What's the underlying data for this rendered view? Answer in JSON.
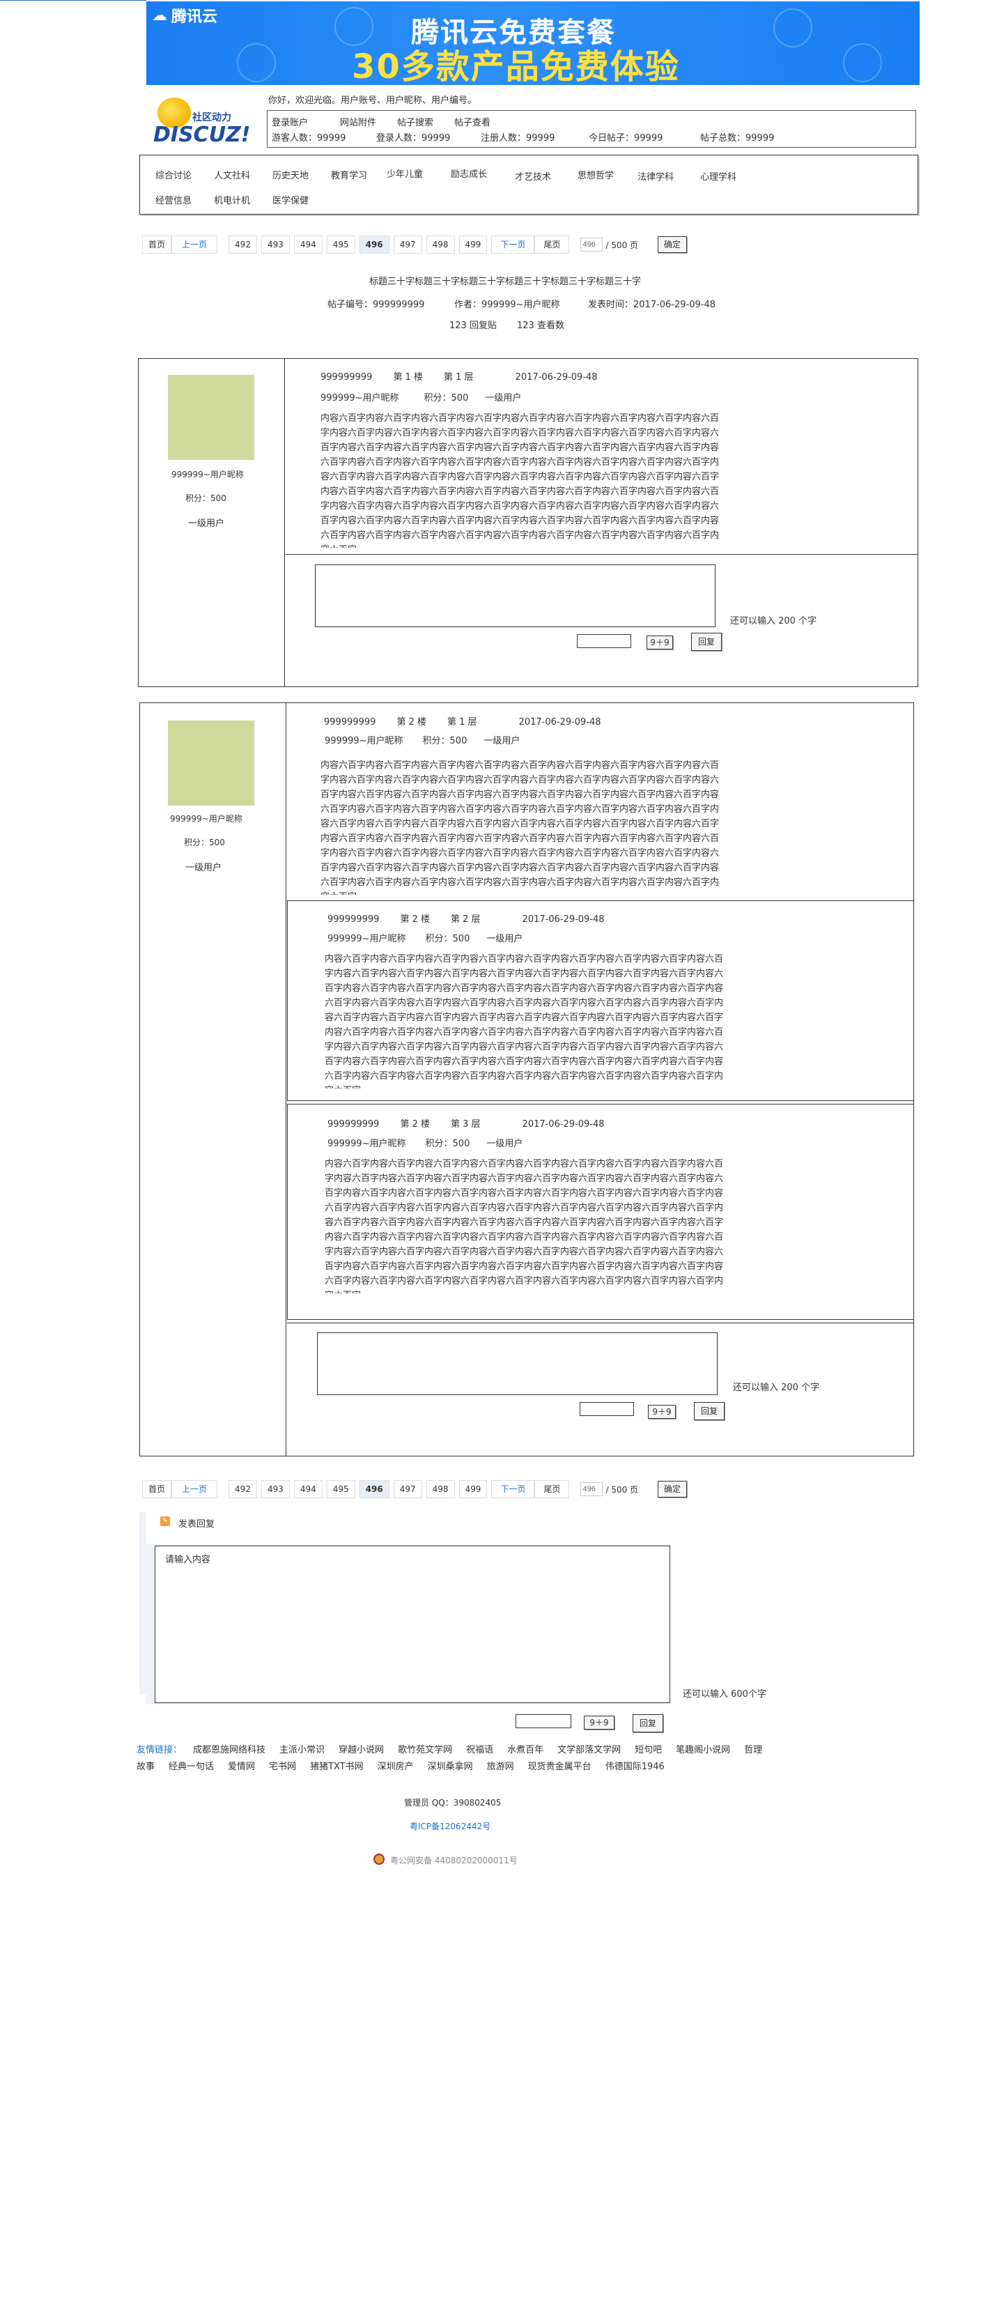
{
  "banner": {
    "brand": "腾讯云",
    "title_line1": "腾讯云免费套餐",
    "title_line2": "30多款产品免费体验"
  },
  "logo": {
    "text_top": "社区动力",
    "text_main": "DISCUZ!"
  },
  "greeting": "你好，欢迎光临。用户账号、用户昵称、用户编号。",
  "stats": {
    "row1": [
      "登录账户",
      "网站附件",
      "帖子搜索",
      "帖子查看"
    ],
    "row2": [
      "游客人数：99999",
      "登录人数：99999",
      "注册人数：99999",
      "今日帖子：99999",
      "帖子总数：99999"
    ]
  },
  "nav": {
    "row1": [
      "综合讨论",
      "人文社科",
      "历史天地",
      "教育学习",
      "少年儿童",
      "励志成长",
      "才艺技术",
      "思想哲学",
      "法律学科",
      "心理学科"
    ],
    "row2": [
      "经营信息",
      "机电计机",
      "医学保健"
    ]
  },
  "pager": {
    "first": "首页",
    "prev": "上一页",
    "pages": [
      "492",
      "493",
      "494",
      "495",
      "496",
      "497",
      "498",
      "499"
    ],
    "current": "496",
    "next": "下一页",
    "last": "尾页",
    "input_value": "496",
    "total": "/ 500 页",
    "confirm": "确定"
  },
  "thread": {
    "title": "标题三十字标题三十字标题三十字标题三十字标题三十字标题三十字",
    "number": "帖子编号：999999999",
    "author": "作者：999999~用户昵称",
    "time": "发表时间：2017-06-29-09-48",
    "replies": "123 回复贴",
    "views": "123 查看数"
  },
  "user": {
    "nickname": "999999~用户昵称",
    "score": "积分：500",
    "level": "一级用户",
    "score_inline": "积分：500"
  },
  "post_body": "内容六百字内容六百字内容六百字内容六百字内容六百字内容六百字内容六百字内容六百字内容六百字内容六百字内容六百字内容六百字内容六百字内容六百字内容六百字内容六百字内容六百字内容六百字内容六百字内容六百字内容六百字内容六百字内容六百字内容六百字内容六百字内容六百字内容六百字内容六百字内容六百字内容六百字内容六百字内容六百字内容六百字内容六百字内容六百字内容六百字内容六百字内容六百字内容六百字内容六百字内容六百字内容六百字内容六百字内容六百字内容六百字内容六百字内容六百字内容六百字内容六百字内容六百字内容六百字内容六百字内容六百字内容六百字内容六百字内容六百字内容六百字内容六百字内容六百字内容六百字内容六百字内容六百字内容六百字内容六百字内容六百字内容六百字内容六百字内容六百字内容六百字内容六百字内容六百字内容六百字内容六百字内容六百字内容六百字内容六百字内容六百字内容六百字内容六百字内容六百字",
  "posts": [
    {
      "id": "999999999",
      "floor": "第 1 楼",
      "layer": "第 1 层",
      "time": "2017-06-29-09-48"
    },
    {
      "id": "999999999",
      "floor": "第 2 楼",
      "layer": "第 1 层",
      "time": "2017-06-29-09-48"
    },
    {
      "id": "999999999",
      "floor": "第 2 楼",
      "layer": "第 2 层",
      "time": "2017-06-29-09-48"
    },
    {
      "id": "999999999",
      "floor": "第 2 楼",
      "layer": "第 3 层",
      "time": "2017-06-29-09-48"
    }
  ],
  "reply_box": {
    "remaining": "还可以输入 200 个字",
    "captcha": "9＋9",
    "reply_btn": "回复"
  },
  "main_reply": {
    "title": "发表回复",
    "placeholder": "请输入内容",
    "remaining": "还可以输入 600个字",
    "captcha": "9＋9",
    "reply_btn": "回复"
  },
  "friend_links": {
    "label": "友情链接：",
    "items": [
      "成都恩施网络科技",
      "主派小常识",
      "穿越小说网",
      "歌竹苑文学网",
      "祝福语",
      "水煮百年",
      "文学部落文学网",
      "短句吧",
      "笔趣阁小说网",
      "哲理故事",
      "经典一句话",
      "爱情网",
      "宅书网",
      "猪猪TXT书网",
      "深圳房产",
      "深圳桑拿网",
      "旅游网",
      "现货贵金属平台",
      "伟德国际1946"
    ]
  },
  "footer": {
    "admin": "管理员 QQ：390802405",
    "icp": "粤ICP备12062442号",
    "police": "粤公网安备 44080202000011号"
  },
  "colors": {
    "banner_blue": "#1a7ef2",
    "banner_yellow": "#ffe042",
    "link_blue": "#1a70c7",
    "avatar": "#cfd99b"
  }
}
